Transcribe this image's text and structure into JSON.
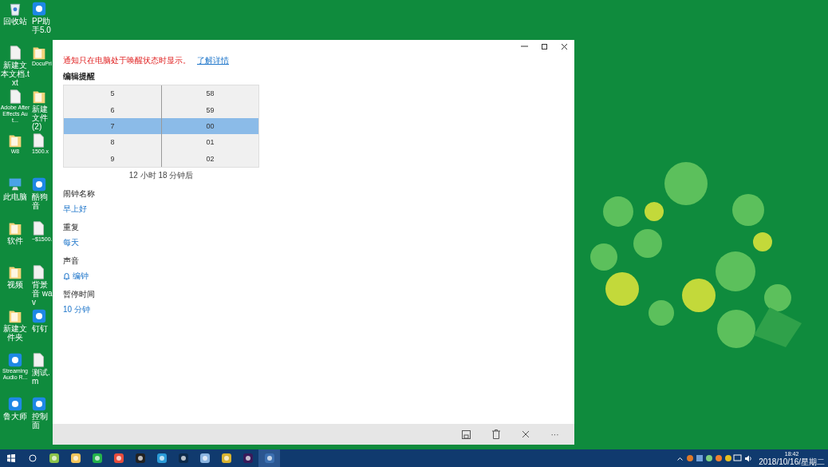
{
  "desktop_icons": [
    {
      "label": "回收站",
      "kind": "recycle"
    },
    {
      "label": "PP助手5.0",
      "kind": "app"
    },
    {
      "label": "新建文本文档.txt",
      "kind": "file"
    },
    {
      "label": "DocuPri",
      "kind": "folder"
    },
    {
      "label": "Adobe After Effects Aut...",
      "kind": "file"
    },
    {
      "label": "新建文件 (2)",
      "kind": "folder"
    },
    {
      "label": "W8",
      "kind": "folder"
    },
    {
      "label": "1500.x",
      "kind": "file"
    },
    {
      "label": "此电脑",
      "kind": "pc"
    },
    {
      "label": "酷狗音",
      "kind": "app"
    },
    {
      "label": "软件",
      "kind": "folder"
    },
    {
      "label": "~$1500.",
      "kind": "file"
    },
    {
      "label": "视频",
      "kind": "folder"
    },
    {
      "label": "背景音 wav",
      "kind": "file"
    },
    {
      "label": "新建文件夹",
      "kind": "folder"
    },
    {
      "label": "钉钉",
      "kind": "app"
    },
    {
      "label": "Streaming Audio R...",
      "kind": "app"
    },
    {
      "label": "测试.m",
      "kind": "file"
    },
    {
      "label": "鲁大师",
      "kind": "app"
    },
    {
      "label": "控制面",
      "kind": "app"
    }
  ],
  "window": {
    "notice": {
      "text": "通知只在电脑处于唤醒状态时显示。",
      "link": "了解详情"
    },
    "section_title": "编辑提醒",
    "time_picker": {
      "hours": [
        {
          "value": "5",
          "selected": false
        },
        {
          "value": "6",
          "selected": false
        },
        {
          "value": "7",
          "selected": true
        },
        {
          "value": "8",
          "selected": false
        },
        {
          "value": "9",
          "selected": false
        }
      ],
      "minutes": [
        {
          "value": "58",
          "selected": false
        },
        {
          "value": "59",
          "selected": false
        },
        {
          "value": "00",
          "selected": true
        },
        {
          "value": "01",
          "selected": false
        },
        {
          "value": "02",
          "selected": false
        }
      ]
    },
    "countdown": "12 小时 18 分钟后",
    "fields": [
      {
        "label": "闹钟名称",
        "value": "早上好",
        "kind": "text"
      },
      {
        "label": "重复",
        "value": "每天",
        "kind": "text"
      },
      {
        "label": "声音",
        "value": "编钟",
        "kind": "sound"
      },
      {
        "label": "暂停时间",
        "value": "10 分钟",
        "kind": "text"
      }
    ],
    "command_bar": [
      {
        "kind": "save"
      },
      {
        "kind": "delete"
      },
      {
        "kind": "close"
      },
      {
        "kind": "more",
        "label": "···"
      }
    ]
  },
  "taskbar": {
    "apps": [
      {
        "selected": false
      },
      {
        "selected": false
      },
      {
        "selected": false
      },
      {
        "selected": false
      },
      {
        "selected": false
      },
      {
        "selected": false
      },
      {
        "selected": false
      },
      {
        "selected": false
      },
      {
        "selected": false
      },
      {
        "selected": false
      },
      {
        "selected": true
      }
    ],
    "time": "18:42",
    "date": "2018/10/16/星期二"
  }
}
